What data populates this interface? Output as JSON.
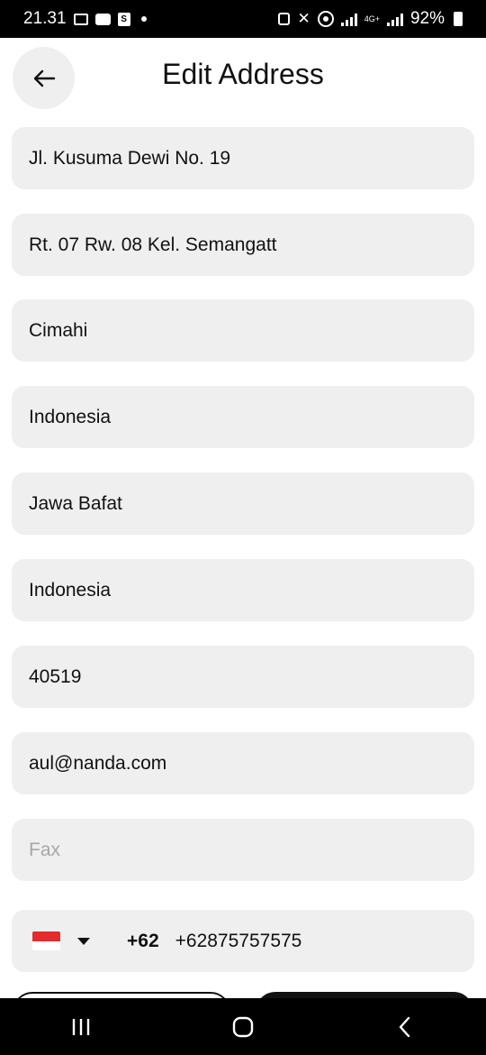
{
  "status_bar": {
    "time": "21.31",
    "battery": "92%",
    "network": "4G+"
  },
  "header": {
    "title": "Edit Address",
    "back_icon": "arrow-left-icon"
  },
  "form": {
    "fields": [
      {
        "value": "Jl. Kusuma Dewi No. 19",
        "placeholder": ""
      },
      {
        "value": "Rt. 07 Rw. 08 Kel. Semangatt",
        "placeholder": ""
      },
      {
        "value": "Cimahi",
        "placeholder": ""
      },
      {
        "value": "Indonesia",
        "placeholder": ""
      },
      {
        "value": "Jawa Bafat",
        "placeholder": ""
      },
      {
        "value": "Indonesia",
        "placeholder": ""
      },
      {
        "value": "40519",
        "placeholder": ""
      },
      {
        "value": "aul@nanda.com",
        "placeholder": ""
      },
      {
        "value": "",
        "placeholder": "Fax"
      }
    ],
    "phone": {
      "country_flag": "indonesia-flag-icon",
      "dial_code": "+62",
      "value": "+62875757575"
    }
  },
  "colors": {
    "field_bg": "#efefef",
    "text": "#111111",
    "placeholder": "#a7a7a7",
    "flag_red": "#e32d2d"
  }
}
